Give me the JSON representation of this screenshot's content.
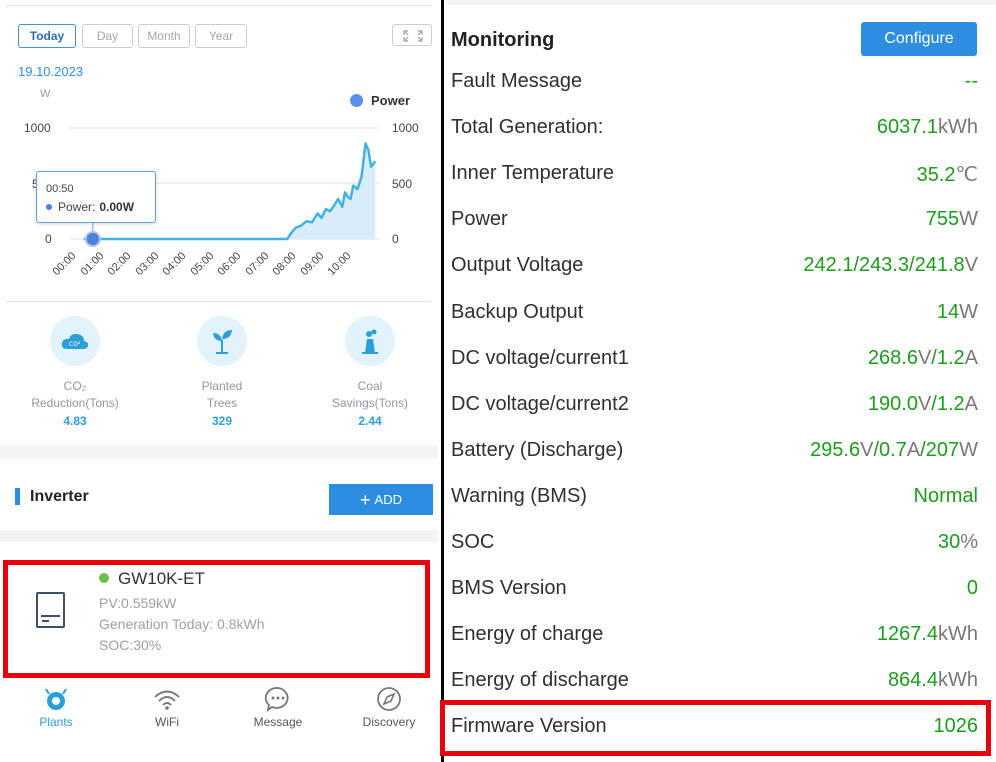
{
  "left": {
    "range_tabs": [
      "Today",
      "Day",
      "Month",
      "Year"
    ],
    "date": "19.10.2023",
    "chart_data": {
      "type": "area",
      "title": "",
      "ylabel": "W",
      "legend": [
        {
          "name": "Power",
          "color": "#5b8def"
        }
      ],
      "legend_position": "top-right",
      "ylim": [
        0,
        1000
      ],
      "y_ticks_left": [
        "1000",
        "500",
        "0"
      ],
      "y_ticks_right": [
        "1000",
        "500",
        "0"
      ],
      "x_ticks": [
        "00:00",
        "01:00",
        "02:00",
        "03:00",
        "04:00",
        "05:00",
        "06:00",
        "07:00",
        "08:00",
        "09:00",
        "10:00"
      ],
      "series": [
        {
          "name": "Power",
          "color": "#3fb3e0",
          "x": [
            0.5,
            0.83,
            1,
            2,
            3,
            4,
            5,
            6,
            7,
            7.9,
            8.0,
            8.2,
            8.4,
            8.6,
            8.8,
            9.0,
            9.15,
            9.3,
            9.45,
            9.6,
            9.75,
            9.9,
            10.0,
            10.1,
            10.2,
            10.3,
            10.45,
            10.6,
            10.75,
            10.85,
            10.95,
            11.1
          ],
          "y": [
            0,
            0,
            0,
            0,
            0,
            0,
            0,
            0,
            0,
            0,
            40,
            100,
            120,
            160,
            150,
            230,
            190,
            270,
            250,
            300,
            360,
            290,
            420,
            380,
            360,
            480,
            450,
            560,
            860,
            800,
            650,
            700
          ]
        }
      ],
      "tooltip": {
        "time": "00:50",
        "label": "Power:",
        "value": "0.00W"
      }
    },
    "stats": [
      {
        "icon": "co2-cloud-icon",
        "label1": "CO₂",
        "label2": "Reduction(Tons)",
        "value": "4.83"
      },
      {
        "icon": "plant-icon",
        "label1": "Planted",
        "label2": "Trees",
        "value": "329"
      },
      {
        "icon": "coal-plant-icon",
        "label1": "Coal",
        "label2": "Savings(Tons)",
        "value": "2.44"
      }
    ],
    "inverter_section": {
      "title": "Inverter",
      "add_label": "ADD"
    },
    "inverter": {
      "name": "GW10K-ET",
      "status_color": "#6cc04a",
      "pv": "PV:0.559kW",
      "generation": "Generation Today: 0.8kWh",
      "soc": "SOC:30%"
    },
    "tabs": [
      {
        "icon": "plants-icon",
        "label": "Plants",
        "active": true
      },
      {
        "icon": "wifi-icon",
        "label": "WiFi",
        "active": false
      },
      {
        "icon": "message-icon",
        "label": "Message",
        "active": false
      },
      {
        "icon": "discovery-icon",
        "label": "Discovery",
        "active": false
      }
    ]
  },
  "right": {
    "title": "Monitoring",
    "configure_label": "Configure",
    "rows": [
      {
        "label": "Fault Message",
        "parts": [
          [
            "v",
            "--"
          ]
        ]
      },
      {
        "label": "Total Generation:",
        "parts": [
          [
            "v",
            "6037.1"
          ],
          [
            "u",
            "kWh"
          ]
        ]
      },
      {
        "label": "Inner Temperature",
        "parts": [
          [
            "v",
            "35.2"
          ],
          [
            "u",
            "℃"
          ]
        ]
      },
      {
        "label": "Power",
        "parts": [
          [
            "v",
            "755"
          ],
          [
            "u",
            "W"
          ]
        ]
      },
      {
        "label": "Output Voltage",
        "parts": [
          [
            "v",
            "242.1/243.3/241.8"
          ],
          [
            "u",
            "V"
          ]
        ]
      },
      {
        "label": "Backup Output",
        "parts": [
          [
            "v",
            "14"
          ],
          [
            "u",
            "W"
          ]
        ]
      },
      {
        "label": "DC voltage/current1",
        "parts": [
          [
            "v",
            "268.6"
          ],
          [
            "u",
            "V"
          ],
          [
            "v",
            "/1.2"
          ],
          [
            "u",
            "A"
          ]
        ]
      },
      {
        "label": "DC voltage/current2",
        "parts": [
          [
            "v",
            "190.0"
          ],
          [
            "u",
            "V"
          ],
          [
            "v",
            "/1.2"
          ],
          [
            "u",
            "A"
          ]
        ]
      },
      {
        "label": "Battery (Discharge)",
        "parts": [
          [
            "v",
            "295.6"
          ],
          [
            "u",
            "V"
          ],
          [
            "v",
            "/0.7"
          ],
          [
            "u",
            "A"
          ],
          [
            "v",
            "/207"
          ],
          [
            "u",
            "W"
          ]
        ]
      },
      {
        "label": "Warning (BMS)",
        "parts": [
          [
            "v",
            "Normal"
          ]
        ]
      },
      {
        "label": "SOC",
        "parts": [
          [
            "v",
            "30"
          ],
          [
            "u",
            "%"
          ]
        ]
      },
      {
        "label": "BMS Version",
        "parts": [
          [
            "v",
            "0"
          ]
        ]
      },
      {
        "label": "Energy of charge",
        "parts": [
          [
            "v",
            "1267.4"
          ],
          [
            "u",
            "kWh"
          ]
        ]
      },
      {
        "label": "Energy of discharge",
        "parts": [
          [
            "v",
            "864.4"
          ],
          [
            "u",
            "kWh"
          ]
        ]
      },
      {
        "label": "Firmware Version",
        "parts": [
          [
            "v",
            "1026"
          ]
        ]
      }
    ]
  },
  "colors": {
    "accent": "#2d8ee0",
    "value_green": "#1c9c1c",
    "highlight_red": "#e8000b",
    "divider": "#000000"
  }
}
